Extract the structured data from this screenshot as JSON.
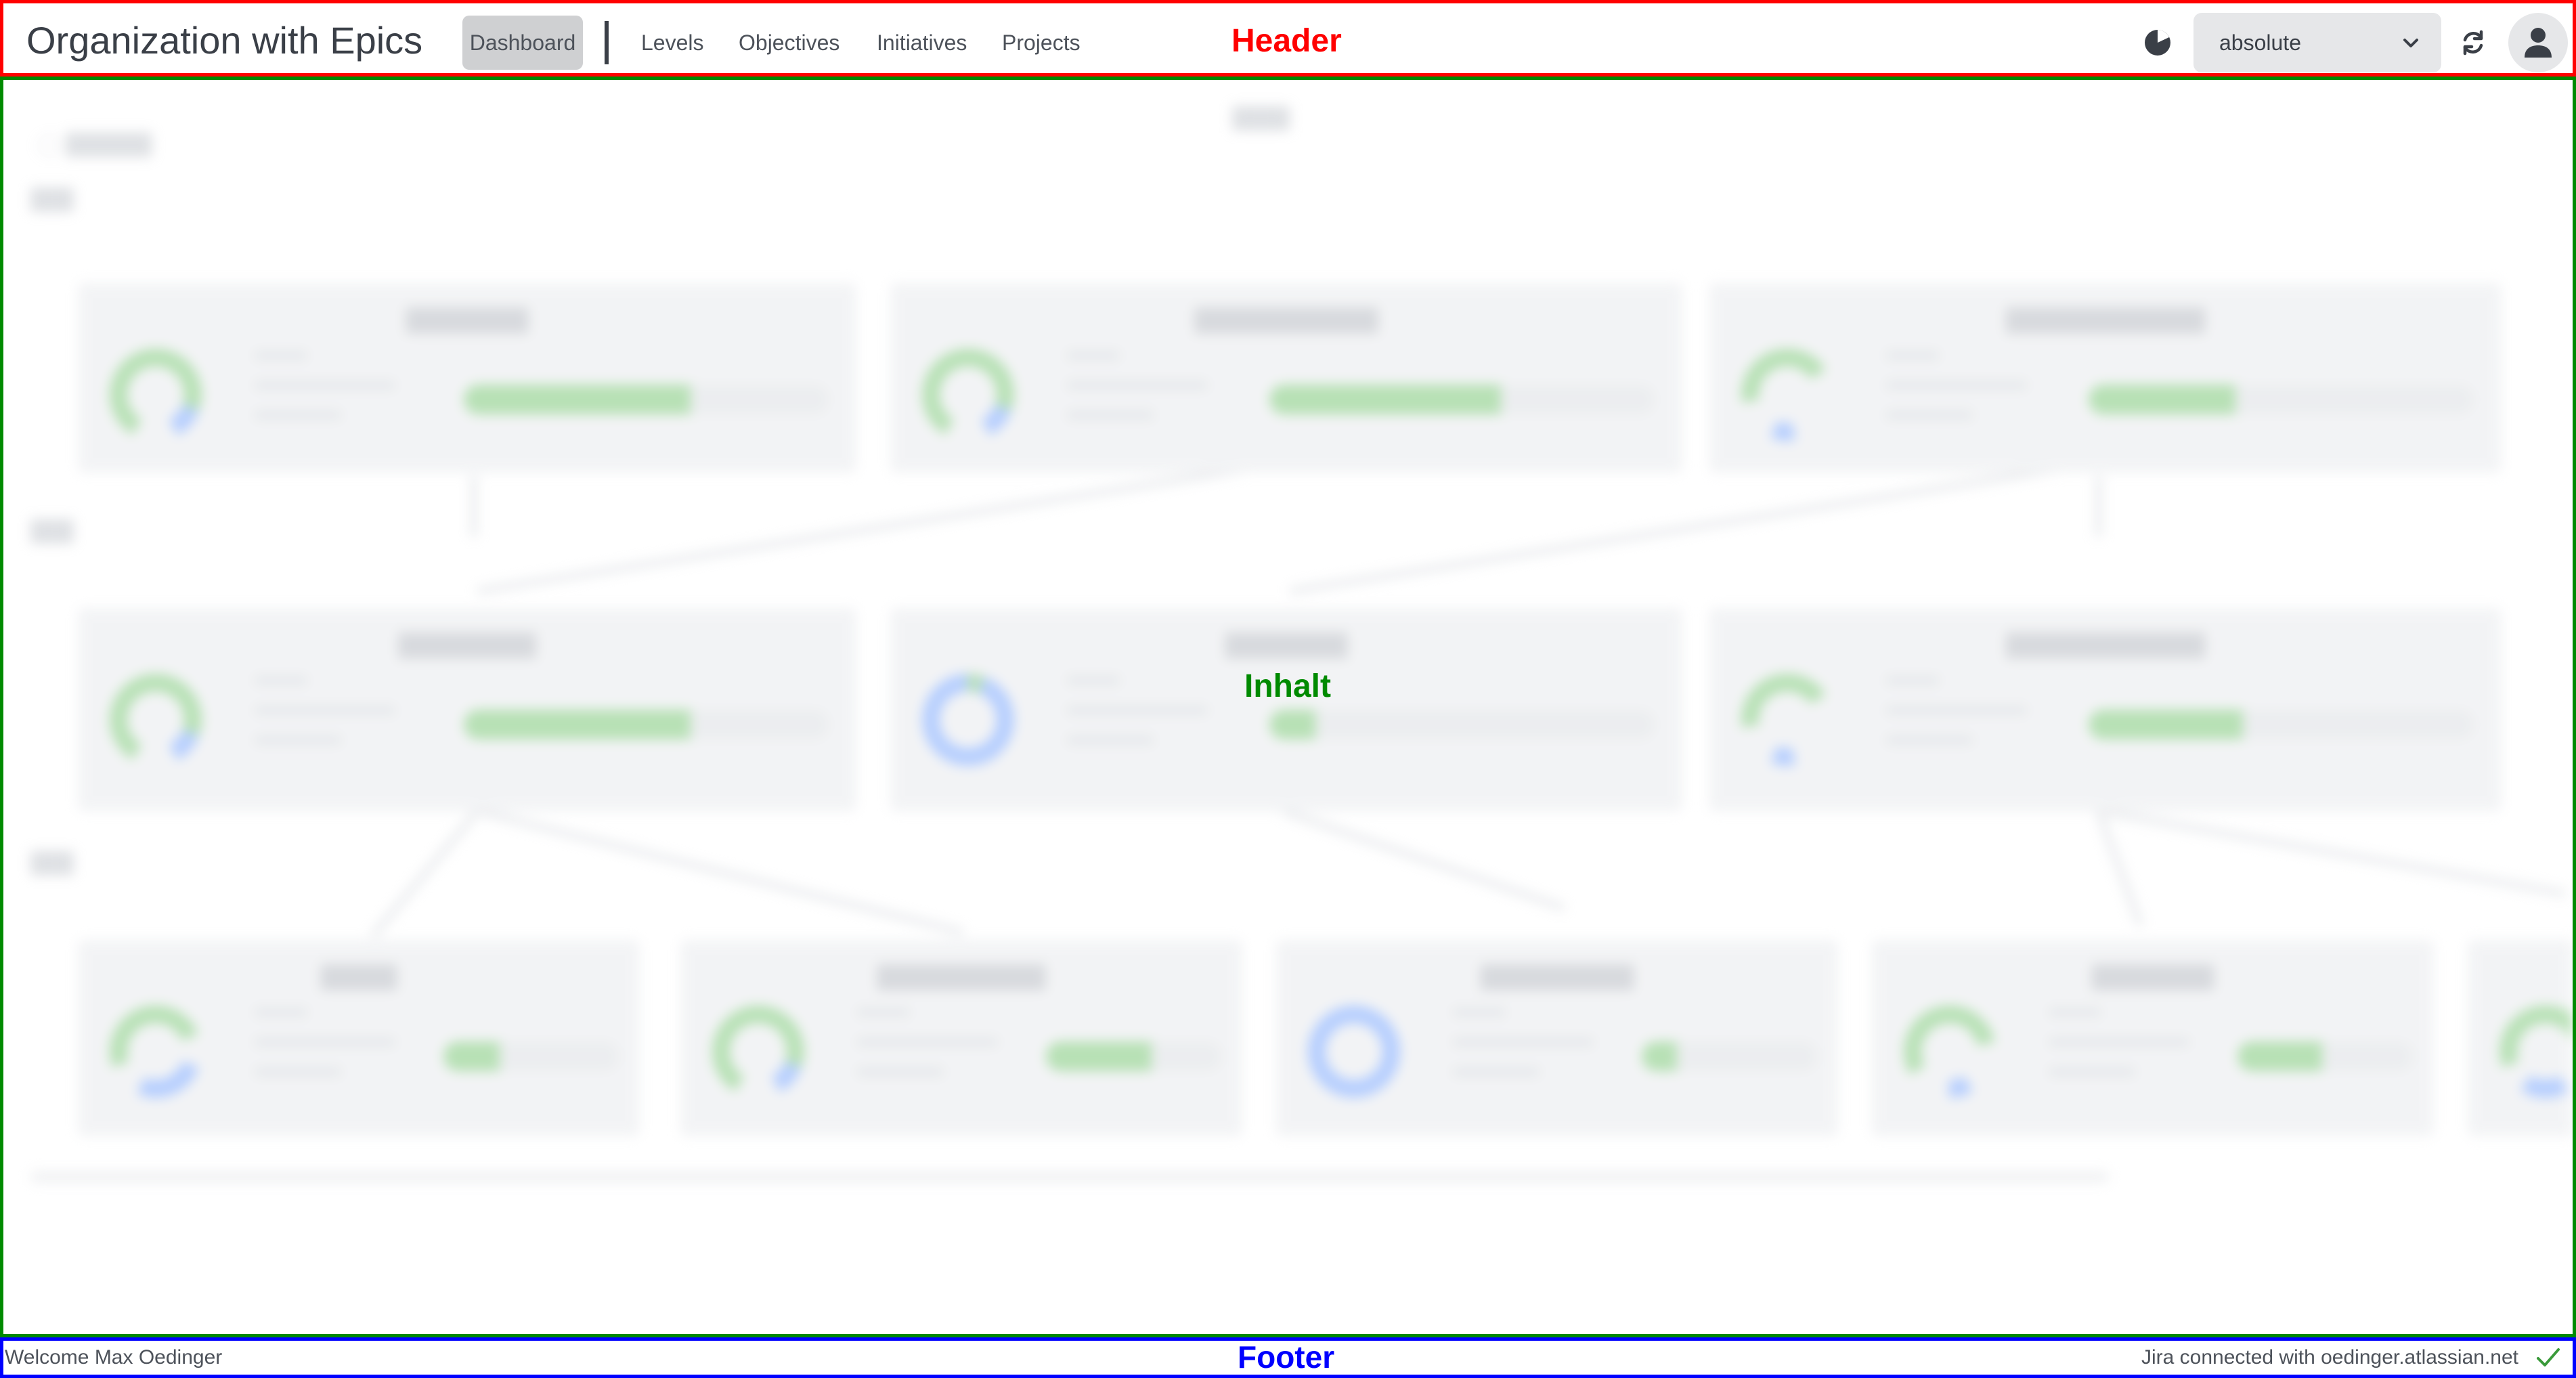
{
  "header": {
    "app_title": "Organization with Epics",
    "nav": {
      "dashboard": "Dashboard",
      "levels": "Levels",
      "objectives": "Objectives",
      "initiatives": "Initiatives",
      "projects": "Projects"
    },
    "section_label": "Header",
    "mode_select": {
      "value": "absolute"
    },
    "icons": [
      "pie-chart-icon",
      "chevron-down-icon",
      "refresh-icon",
      "user-icon"
    ]
  },
  "content": {
    "section_label": "Inhalt",
    "obscured": true
  },
  "footer": {
    "welcome": "Welcome Max Oedinger",
    "section_label": "Footer",
    "status": "Jira connected with oedinger.atlassian.net",
    "status_icon": "check-icon"
  },
  "colors": {
    "header_border": "#ff0000",
    "content_border": "#008a00",
    "footer_border": "#0000ff",
    "progress_green": "#7ec97a",
    "progress_blue": "#7aa7ff"
  }
}
